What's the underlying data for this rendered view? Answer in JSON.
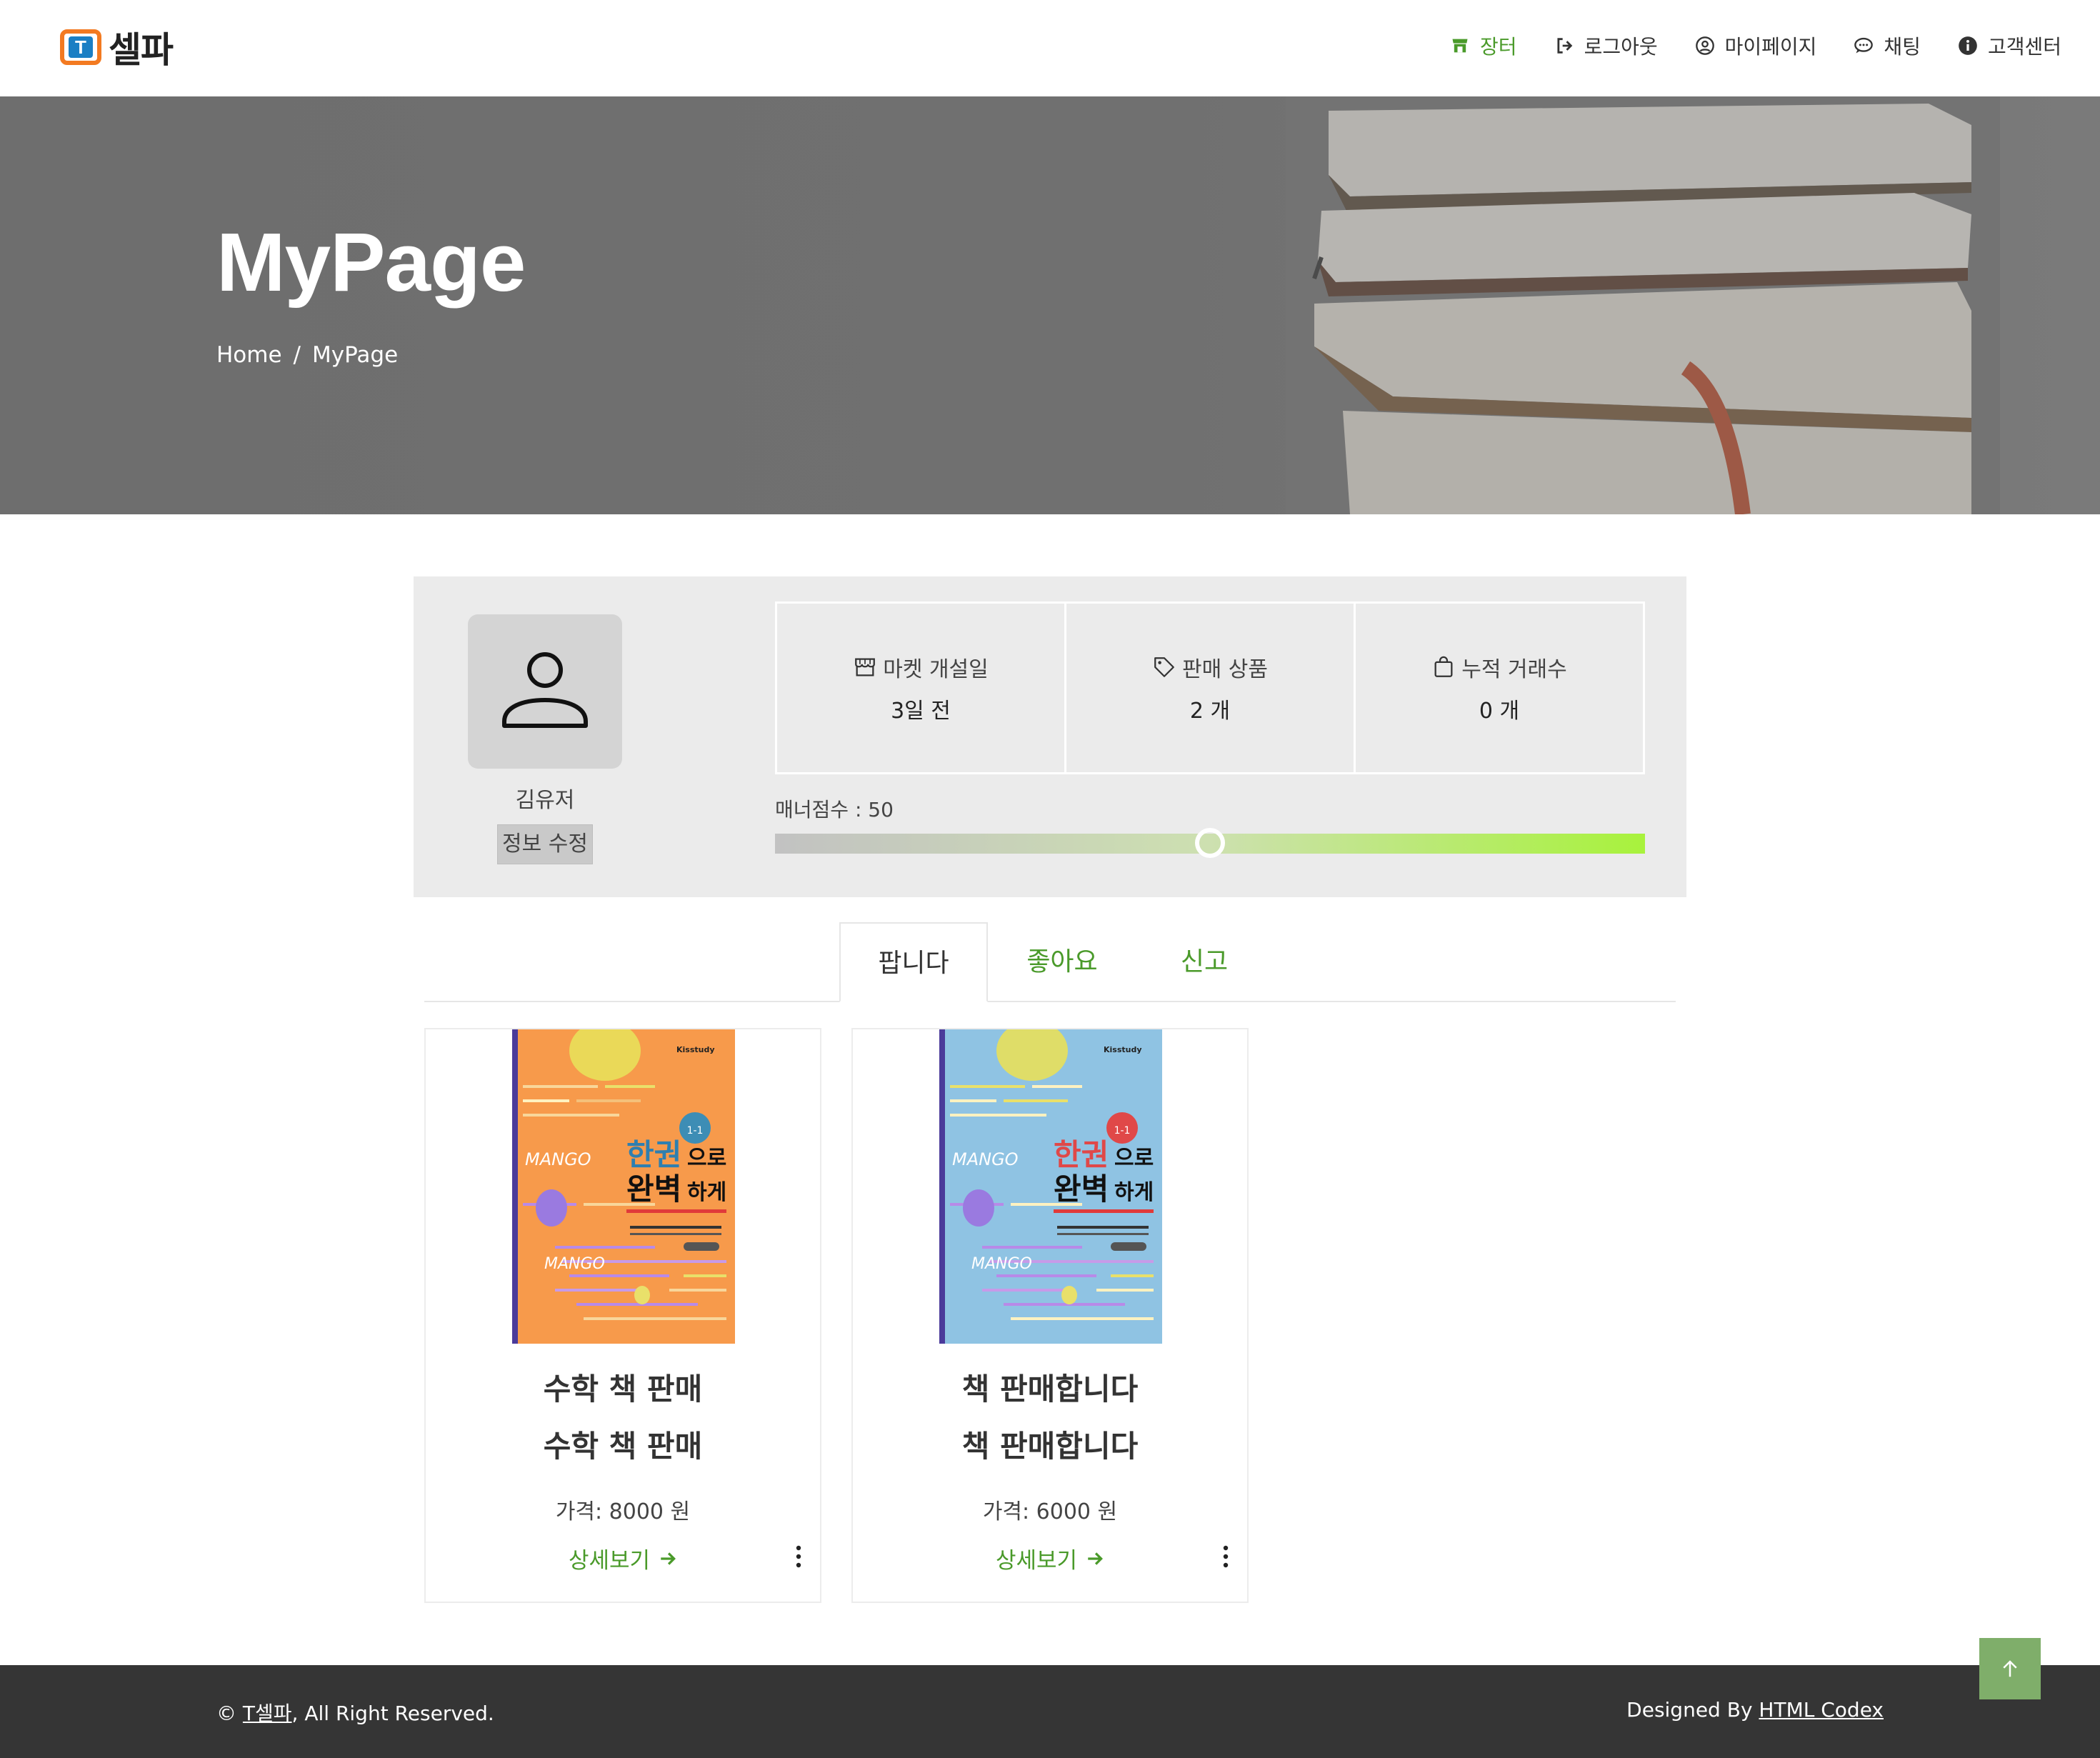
{
  "brand": {
    "name": "셀파",
    "mark_letter": "T"
  },
  "nav": {
    "items": [
      {
        "label": "장터",
        "icon": "store-icon"
      },
      {
        "label": "로그아웃",
        "icon": "logout-icon"
      },
      {
        "label": "마이페이지",
        "icon": "user-circle-icon"
      },
      {
        "label": "채팅",
        "icon": "chat-icon"
      },
      {
        "label": "고객센터",
        "icon": "info-icon"
      }
    ],
    "active_color": "#4a9a2a"
  },
  "hero": {
    "title": "MyPage",
    "breadcrumb": {
      "home": "Home",
      "separator": "/",
      "current": "MyPage"
    }
  },
  "profile": {
    "username": "김유저",
    "edit_label": "정보 수정",
    "stats": [
      {
        "label": "마켓 개설일",
        "value": "3일 전",
        "icon": "shop-icon"
      },
      {
        "label": "판매 상품",
        "value": "2 개",
        "icon": "tag-icon"
      },
      {
        "label": "누적 거래수",
        "value": "0 개",
        "icon": "bag-icon"
      }
    ],
    "manner_label": "매너점수 : 50",
    "manner_score": 50
  },
  "tabs": [
    {
      "label": "팝니다",
      "active": true
    },
    {
      "label": "좋아요",
      "active": false
    },
    {
      "label": "신고",
      "active": false
    }
  ],
  "products": [
    {
      "title": "수학 책 판매",
      "subtitle": "수학 책 판매",
      "price": "가격: 8000 원",
      "link": "상세보기",
      "cover": {
        "bg": "#f79a4b",
        "publisher": "Kisstudy",
        "badge": "1-1",
        "line1": "한권",
        "line1b": "으로",
        "line2": "완벽",
        "line2b": "하게",
        "badge_color": "#3d8db5",
        "title_color": "#2e7fb0"
      }
    },
    {
      "title": "책 판매합니다",
      "subtitle": "책 판매합니다",
      "price": "가격: 6000 원",
      "link": "상세보기",
      "cover": {
        "bg": "#8fc3e3",
        "publisher": "Kisstudy",
        "badge": "1-1",
        "line1": "한권",
        "line1b": "으로",
        "line2": "완벽",
        "line2b": "하게",
        "badge_color": "#e04848",
        "title_color": "#e04848"
      }
    }
  ],
  "footer": {
    "copyright_prefix": "©",
    "site_link": "T셀파",
    "rights": ", All Right Reserved.",
    "designed_by": "Designed By",
    "designer_link": "HTML Codex"
  }
}
